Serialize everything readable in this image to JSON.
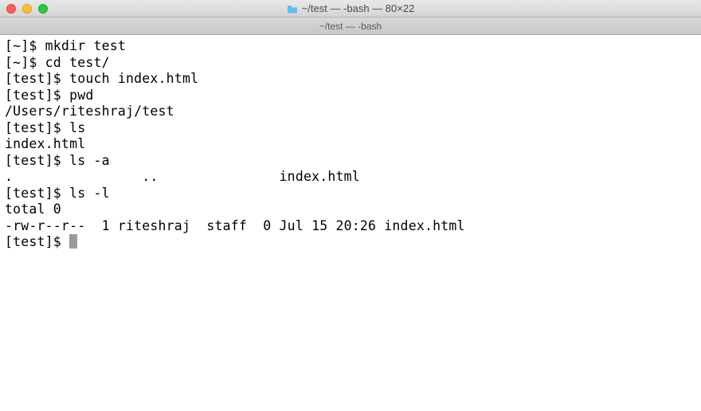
{
  "window": {
    "title": "~/test — -bash — 80×22",
    "tab_title": "~/test — -bash"
  },
  "terminal": {
    "lines": [
      "[~]$ mkdir test",
      "[~]$ cd test/",
      "[test]$ touch index.html",
      "[test]$ pwd",
      "/Users/riteshraj/test",
      "[test]$ ls",
      "index.html",
      "[test]$ ls -a",
      ".                ..               index.html",
      "[test]$ ls -l",
      "total 0",
      "-rw-r--r--  1 riteshraj  staff  0 Jul 15 20:26 index.html",
      "[test]$ "
    ],
    "cursor_on_last": true
  }
}
